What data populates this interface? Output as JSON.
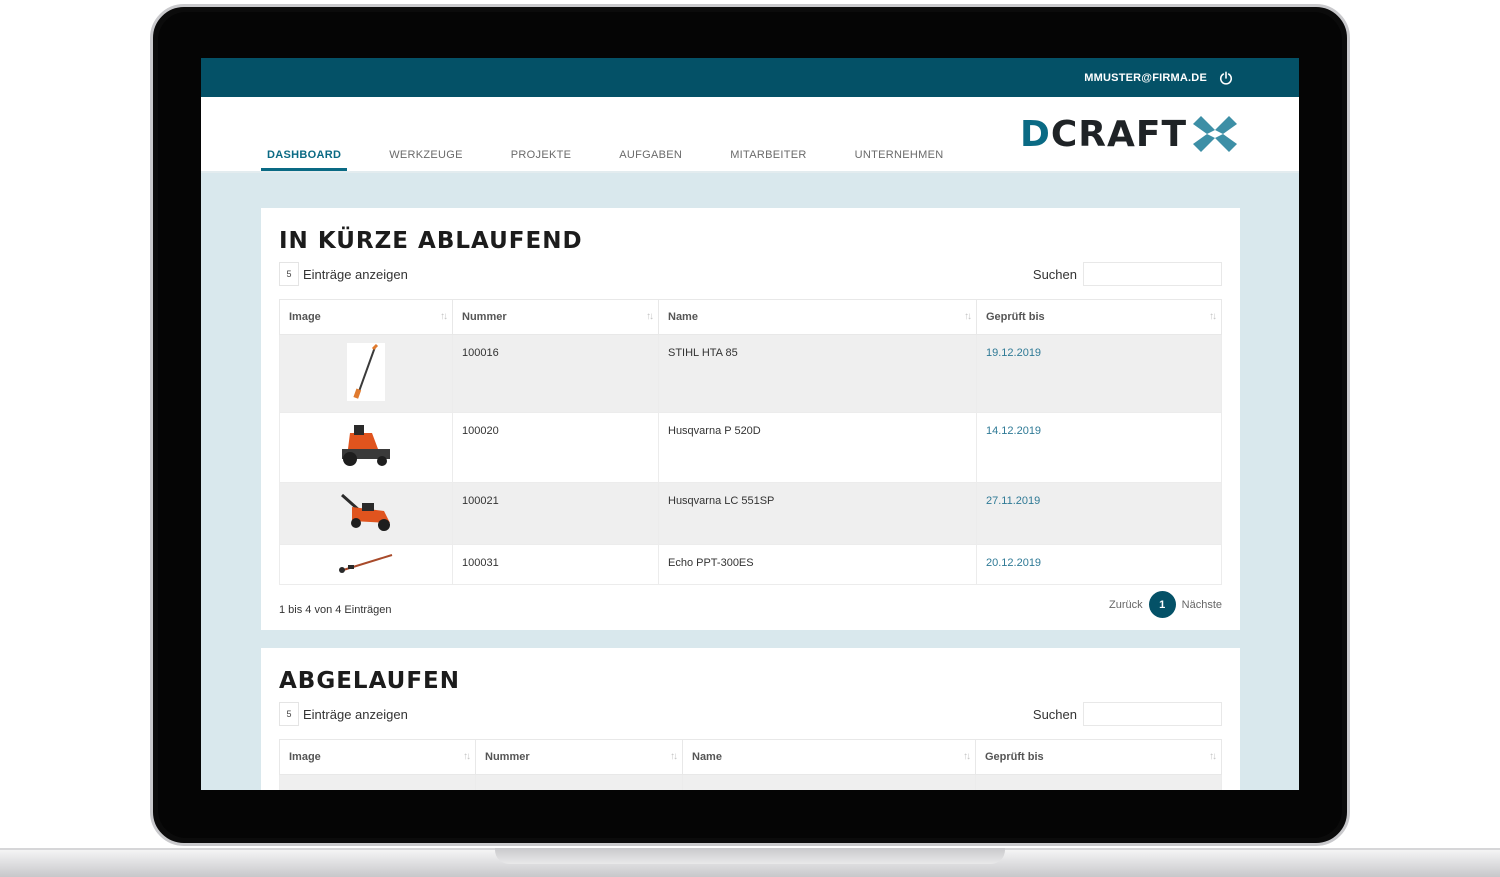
{
  "user": {
    "email": "MMUSTER@FIRMA.DE"
  },
  "nav": {
    "items": [
      {
        "label": "DASHBOARD",
        "active": true
      },
      {
        "label": "WERKZEUGE"
      },
      {
        "label": "PROJEKTE"
      },
      {
        "label": "AUFGABEN"
      },
      {
        "label": "MITARBEITER"
      },
      {
        "label": "UNTERNEHMEN"
      }
    ]
  },
  "logo": {
    "d": "D",
    "rest": "CRAFT"
  },
  "colors": {
    "primary": "#045167",
    "accent": "#0a6a84",
    "background": "#d9e8ed"
  },
  "section1": {
    "title": "IN KÜRZE ABLAUFEND",
    "length_value": "5",
    "length_label": "Einträge anzeigen",
    "search_label": "Suchen",
    "columns": [
      "Image",
      "Nummer",
      "Name",
      "Geprüft bis"
    ],
    "rows": [
      {
        "image": "pole-trimmer-icon",
        "nummer": "100016",
        "name": "STIHL HTA 85",
        "date": "19.12.2019"
      },
      {
        "image": "riding-mower-icon",
        "nummer": "100020",
        "name": "Husqvarna P 520D",
        "date": "14.12.2019"
      },
      {
        "image": "lawn-mower-icon",
        "nummer": "100021",
        "name": "Husqvarna LC 551SP",
        "date": "27.11.2019"
      },
      {
        "image": "pole-saw-icon",
        "nummer": "100031",
        "name": "Echo PPT-300ES",
        "date": "20.12.2019"
      }
    ],
    "info": "1 bis 4 von 4 Einträgen",
    "prev": "Zurück",
    "page": "1",
    "next": "Nächste"
  },
  "section2": {
    "title": "ABGELAUFEN",
    "length_value": "5",
    "length_label": "Einträge anzeigen",
    "search_label": "Suchen",
    "columns": [
      "Image",
      "Nummer",
      "Name",
      "Geprüft bis"
    ]
  }
}
